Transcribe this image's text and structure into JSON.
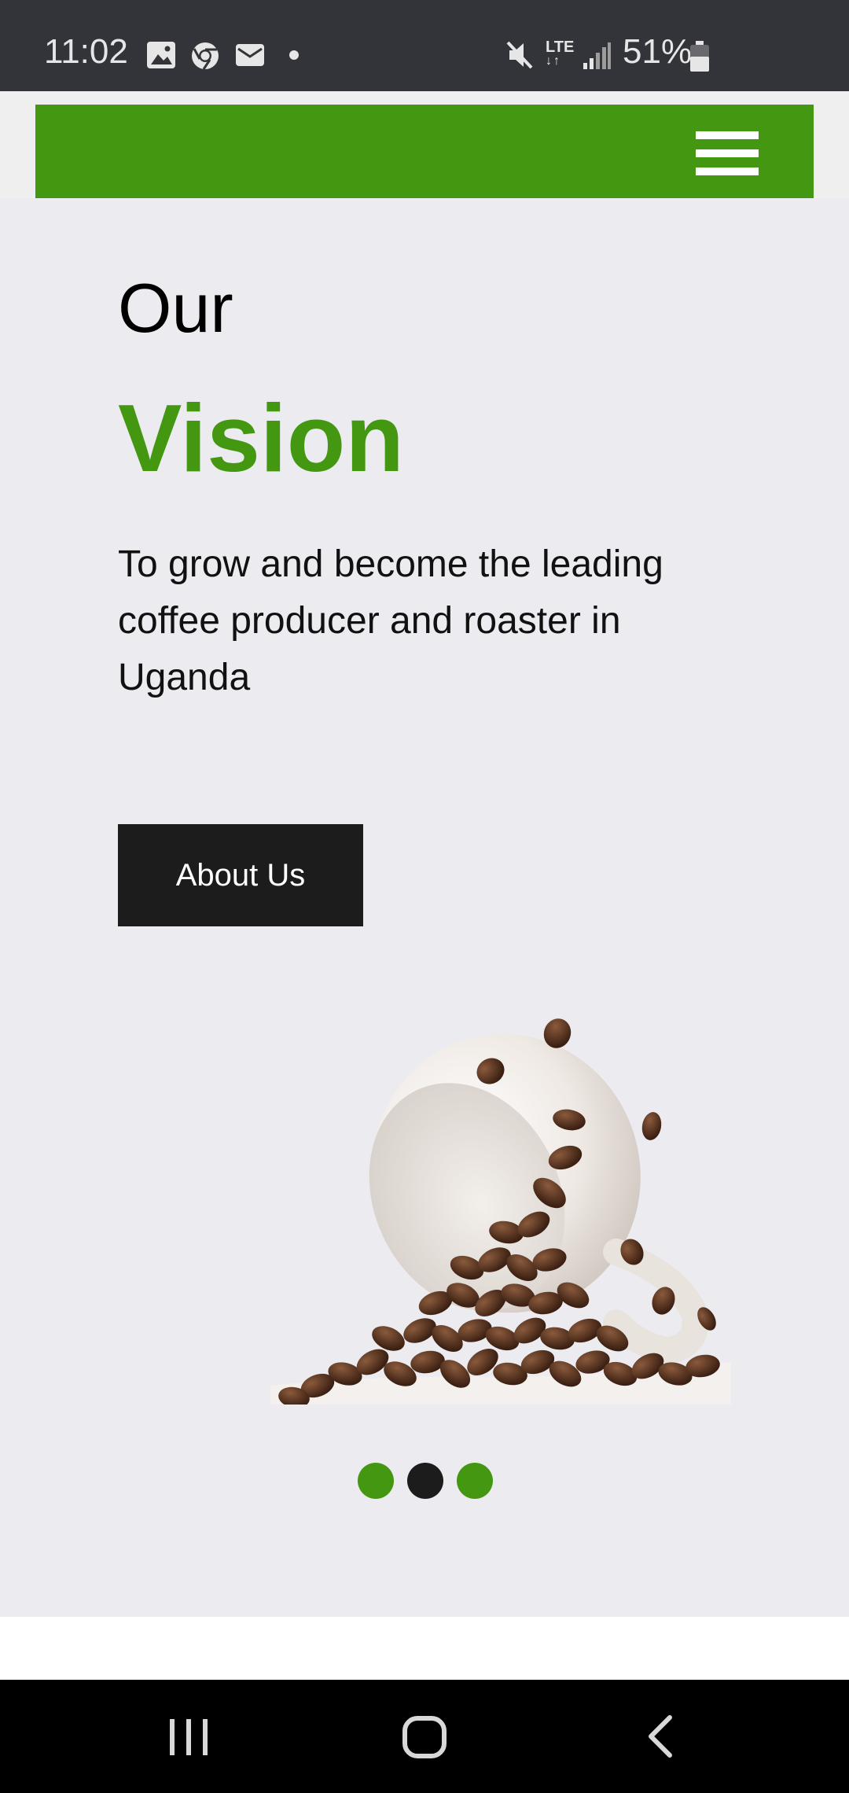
{
  "status_bar": {
    "time": "11:02",
    "battery_percent": "51%",
    "icons": [
      "image-icon",
      "chrome-icon",
      "email-icon",
      "dot-icon",
      "mute-icon",
      "lte-icon",
      "signal-icon",
      "battery-icon"
    ],
    "lte_label": "LTE"
  },
  "header": {
    "menu_icon": "hamburger-menu-icon",
    "color": "#449811"
  },
  "hero": {
    "title_line1": "Our",
    "title_line2": "Vision",
    "description": "To grow and become the leading coffee producer and roaster in Uganda",
    "button_label": "About Us",
    "image": "coffee-cup-beans-image"
  },
  "carousel": {
    "slide_count": 3,
    "active_index": 1,
    "active_color": "#1c1c1c",
    "inactive_color": "#449811"
  },
  "nav_bar": {
    "icons": [
      "recent-apps-icon",
      "home-icon",
      "back-icon"
    ]
  },
  "colors": {
    "brand_green": "#449811",
    "page_bg": "#ebebf0",
    "button_bg": "#1c1c1c"
  }
}
